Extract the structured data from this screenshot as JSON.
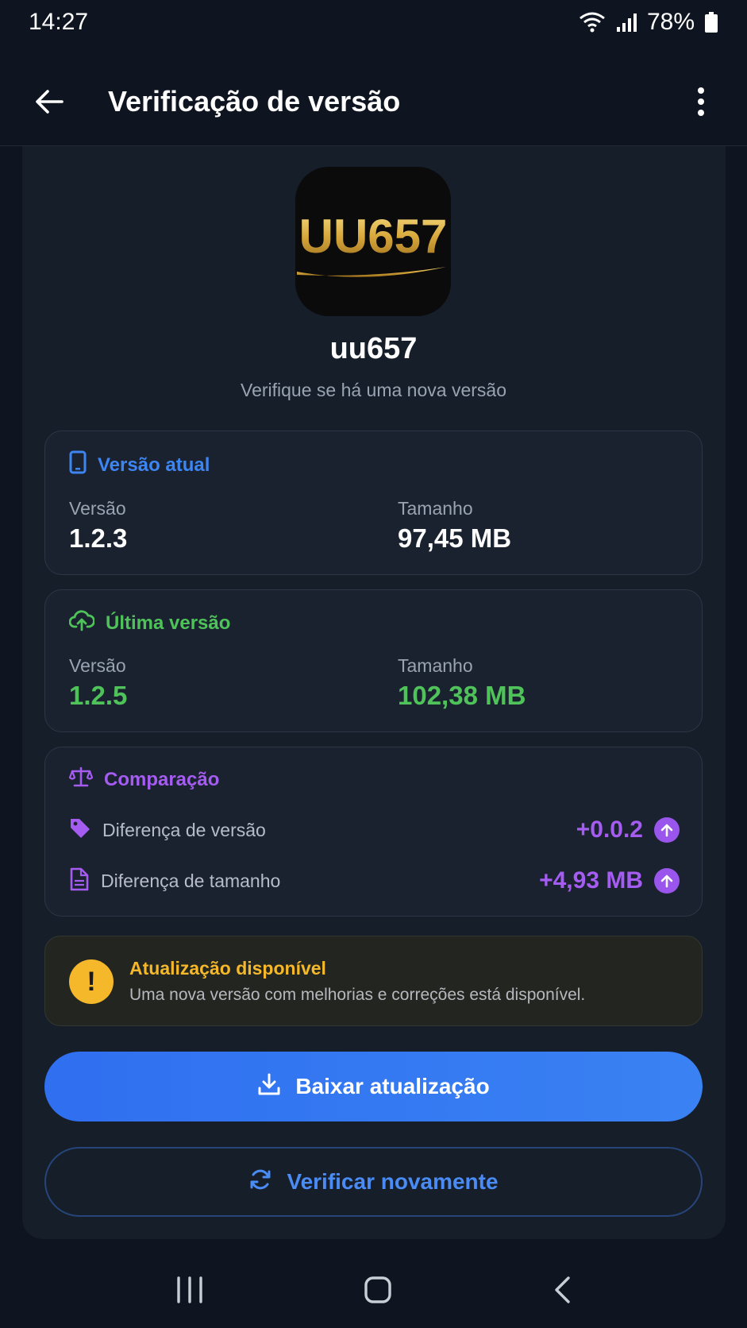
{
  "status_bar": {
    "time": "14:27",
    "battery": "78%"
  },
  "app_bar": {
    "title": "Verificação de versão"
  },
  "app": {
    "logo_text": "UU657",
    "name": "uu657",
    "subtitle": "Verifique se há uma nova versão"
  },
  "current": {
    "title": "Versão atual",
    "version_label": "Versão",
    "version": "1.2.3",
    "size_label": "Tamanho",
    "size": "97,45 MB",
    "color": "#3d86f2"
  },
  "latest": {
    "title": "Última versão",
    "version_label": "Versão",
    "version": "1.2.5",
    "size_label": "Tamanho",
    "size": "102,38 MB",
    "color": "#4fc35a"
  },
  "comparison": {
    "title": "Comparação",
    "rows": [
      {
        "label": "Diferença de versão",
        "value": "+0.0.2",
        "icon": "tag-icon"
      },
      {
        "label": "Diferença de tamanho",
        "value": "+4,93 MB",
        "icon": "file-icon"
      }
    ],
    "color": "#a55cf0"
  },
  "alert": {
    "title": "Atualização disponível",
    "message": "Uma nova versão com melhorias e correções está disponível.",
    "icon_glyph": "!",
    "color": "#f5b82a"
  },
  "buttons": {
    "download": "Baixar atualização",
    "recheck": "Verificar novamente"
  }
}
